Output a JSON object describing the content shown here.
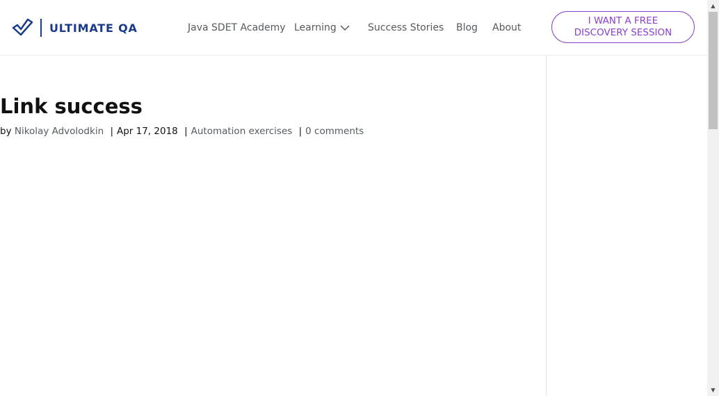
{
  "header": {
    "logo_text": "ULTIMATE QA",
    "nav": [
      {
        "label": "Java SDET Academy"
      },
      {
        "label": "Learning"
      },
      {
        "label": "Success Stories"
      },
      {
        "label": "Blog"
      },
      {
        "label": "About"
      }
    ],
    "cta_line1": "I WANT A FREE",
    "cta_line2": "DISCOVERY SESSION"
  },
  "post": {
    "title": "Link success",
    "meta": {
      "by": "by",
      "author": "Nikolay Advolodkin",
      "separator": "|",
      "date": "Apr 17, 2018",
      "category": "Automation exercises",
      "comments": "0 comments"
    }
  },
  "colors": {
    "brand": "#1a3a8a",
    "accent": "#8a3fcf",
    "nav_text": "#555a5e"
  },
  "icons": {
    "logo": "check-logo-icon",
    "learning_dropdown": "chevron-down-icon",
    "scroll_up": "scroll-up-arrow-icon",
    "scroll_down": "scroll-down-arrow-icon"
  }
}
